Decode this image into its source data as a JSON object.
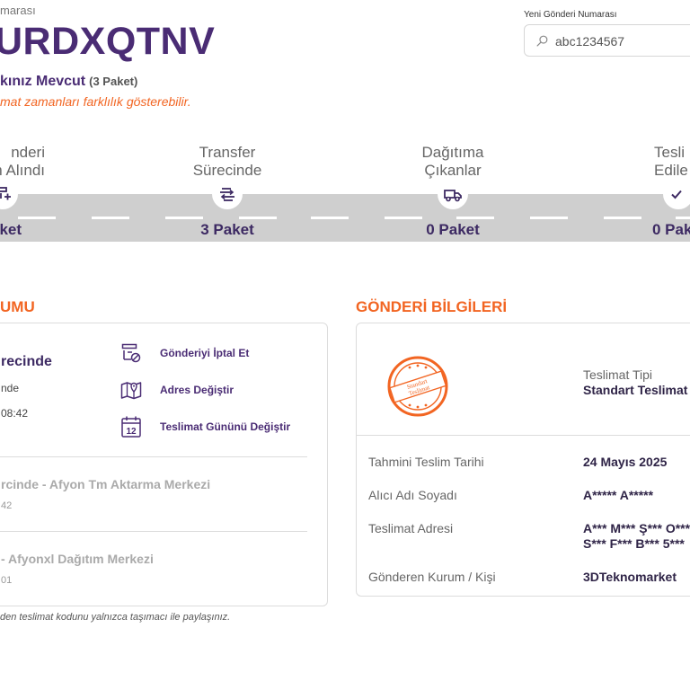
{
  "header": {
    "top_label": "marası",
    "tracking_number": "URDXQTNV",
    "status_text": "kınız Mevcut",
    "package_count": "(3 Paket)",
    "note": "mat zamanları farklılık gösterebilir."
  },
  "search": {
    "label": "Yeni Gönderi Numarası",
    "placeholder": "abc1234567"
  },
  "steps": [
    {
      "title_line1": "nderi",
      "title_line2": "n Alındı",
      "count": "aket",
      "icon": "package-add-icon"
    },
    {
      "title_line1": "Transfer",
      "title_line2": "Sürecinde",
      "count": "3 Paket",
      "icon": "transfer-icon"
    },
    {
      "title_line1": "Dağıtıma",
      "title_line2": "Çıkanlar",
      "count": "0 Paket",
      "icon": "truck-icon"
    },
    {
      "title_line1": "Tesli",
      "title_line2": "Edile",
      "count": "0 Pak",
      "icon": "check-icon"
    }
  ],
  "left_section": {
    "title": "UMU",
    "current_status": "recinde",
    "current_location": "nde",
    "current_time": "08:42",
    "actions": [
      {
        "label": "Gönderiyi İptal Et",
        "icon": "cancel-shipment-icon"
      },
      {
        "label": "Adres Değiştir",
        "icon": "map-icon"
      },
      {
        "label": "Teslimat Gününü Değiştir",
        "icon": "calendar-icon",
        "calendar_day": "12"
      }
    ],
    "history": [
      {
        "title": "rcinde - Afyon Tm Aktarma Merkezi",
        "time": "42"
      },
      {
        "title": " - Afyonxl Dağıtım Merkezi",
        "time": "01"
      }
    ]
  },
  "right_section": {
    "title": "GÖNDERİ BİLGİLERİ",
    "stamp_text_line1": "Standart",
    "stamp_text_line2": "Teslimat",
    "delivery_type_label": "Teslimat Tipi",
    "delivery_type_value": "Standart Teslimat",
    "rows": [
      {
        "label": "Tahmini Teslim Tarihi",
        "value": "24 Mayıs 2025"
      },
      {
        "label": "Alıcı Adı Soyadı",
        "value": "A***** A*****"
      },
      {
        "label": "Teslimat Adresi",
        "value": "A*** M*** Ş*** O***",
        "value2": "S*** F*** B*** 5***"
      },
      {
        "label": "Gönderen Kurum / Kişi",
        "value": "3DTeknomarket"
      }
    ]
  },
  "footnote": "den teslimat kodunu yalnızca taşımacı ile paylaşınız.",
  "colors": {
    "brand_purple": "#4a2c74",
    "accent_orange": "#f26522",
    "road_gray": "#cfcfcf"
  }
}
